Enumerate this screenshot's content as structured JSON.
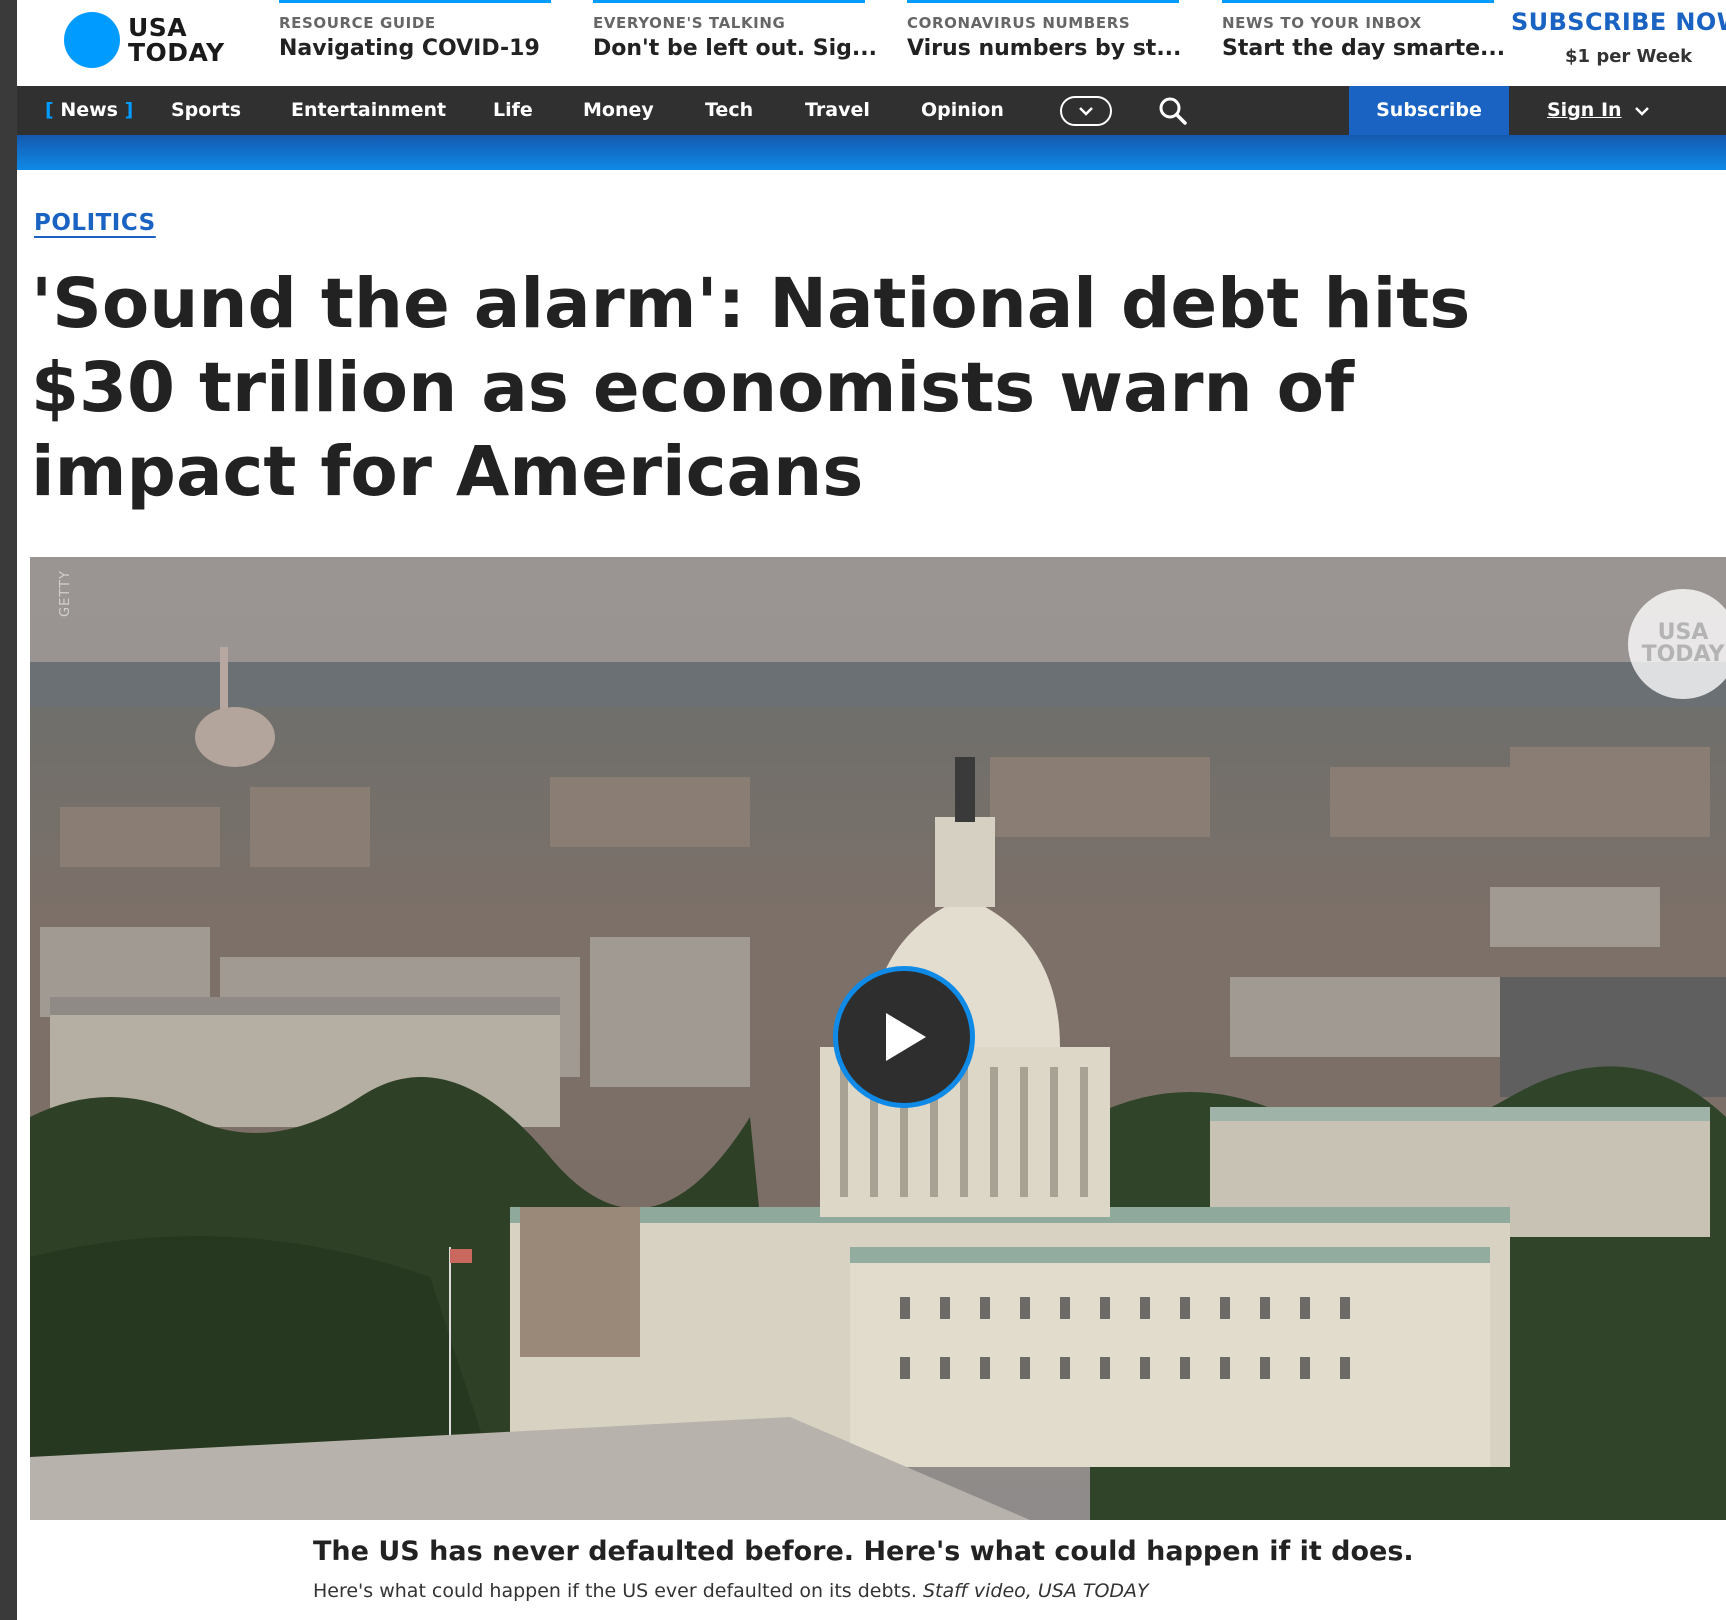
{
  "logo": {
    "line1": "USA",
    "line2": "TODAY"
  },
  "promos": [
    {
      "kicker": "RESOURCE GUIDE",
      "headline": "Navigating COVID-19"
    },
    {
      "kicker": "EVERYONE'S TALKING",
      "headline": "Don't be left out. Sig..."
    },
    {
      "kicker": "CORONAVIRUS NUMBERS",
      "headline": "Virus numbers by st..."
    },
    {
      "kicker": "NEWS TO YOUR INBOX",
      "headline": "Start the day smarte..."
    }
  ],
  "subscribe_promo": {
    "label": "SUBSCRIBE NOW",
    "price": "$1 per Week"
  },
  "nav": {
    "items": [
      "News",
      "Sports",
      "Entertainment",
      "Life",
      "Money",
      "Tech",
      "Travel",
      "Opinion"
    ],
    "subscribe": "Subscribe",
    "sign_in": "Sign In"
  },
  "article": {
    "section": "POLITICS",
    "headline": "'Sound the alarm': National debt hits $30 trillion as economists warn of impact for Americans"
  },
  "video": {
    "watermark": "USA TODAY",
    "photo_credit": "GETTY",
    "caption_title": "The US has never defaulted before. Here's what could happen if it does.",
    "caption_text": "Here's what could happen if the US ever defaulted on its debts.",
    "caption_credit": "Staff video, USA TODAY"
  },
  "colors": {
    "brand_blue": "#009bff",
    "link_blue": "#1a63c2",
    "nav_bg": "#303030"
  }
}
